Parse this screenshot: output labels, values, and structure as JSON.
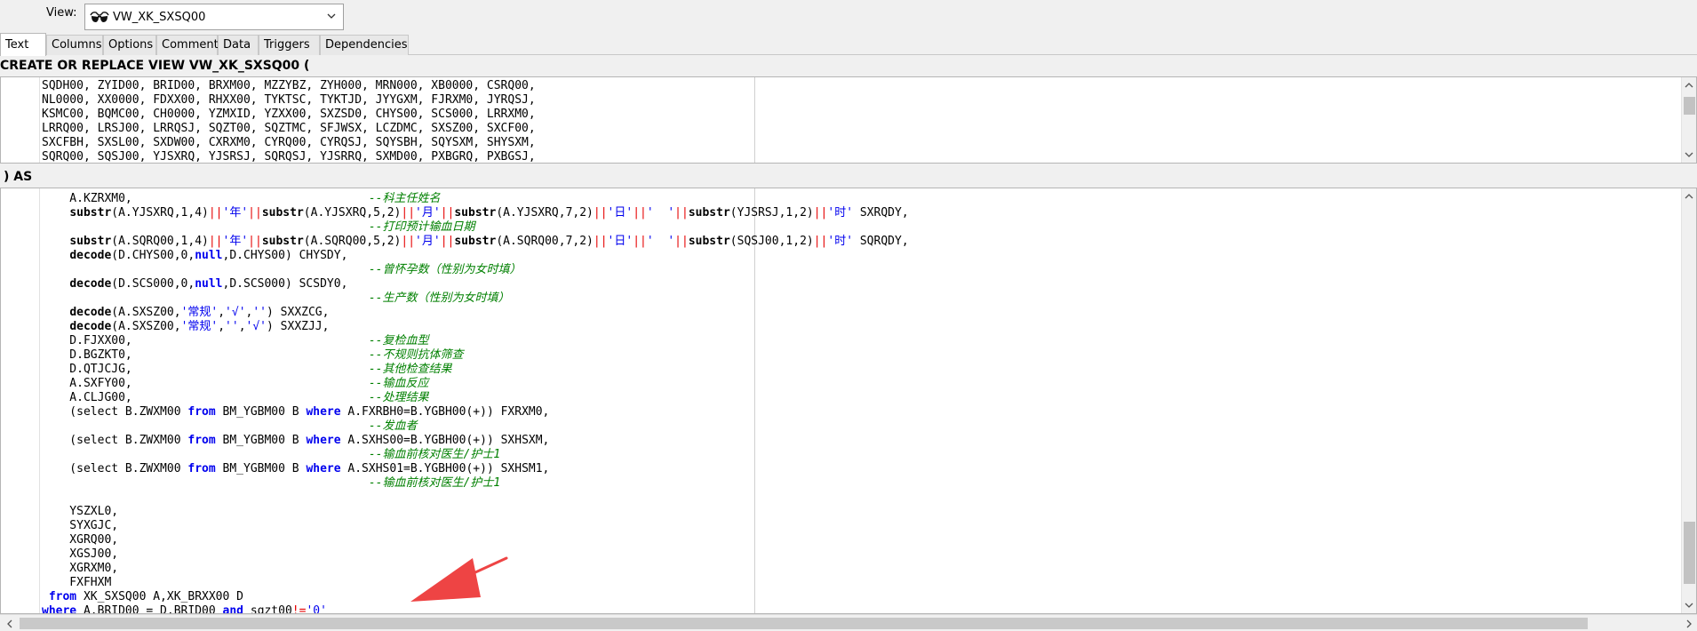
{
  "view_selector": {
    "label": "View:",
    "value": "VW_XK_SXSQ00",
    "icon": "sunglasses-icon"
  },
  "tabs": [
    {
      "label": "Text",
      "active": true
    },
    {
      "label": "Columns",
      "active": false
    },
    {
      "label": "Options",
      "active": false
    },
    {
      "label": "Comment",
      "active": false
    },
    {
      "label": "Data",
      "active": false
    },
    {
      "label": "Triggers",
      "active": false
    },
    {
      "label": "Dependencies",
      "active": false
    }
  ],
  "header_line": "CREATE OR REPLACE VIEW VW_XK_SXSQ00 (",
  "as_line": ") AS",
  "column_list": [
    [
      [
        "id",
        "SQDH00, ZYID00, BRID00, BRXM00, MZZYBZ, ZYH000, MRN000, XB0000, CSRQ00,"
      ]
    ],
    [
      [
        "id",
        "NL0000, XX0000, FDXX00, RHXX00, TYKTSC, TYKTJD, JYYGXM, FJRXM0, JYRQSJ,"
      ]
    ],
    [
      [
        "id",
        "KSMC00, BQMC00, CH0000, YZMXID, YZXX00, SXZSD0, CHYS00, SCS000, LRRXM0,"
      ]
    ],
    [
      [
        "id",
        "LRRQ00, LRSJ00, LRRQSJ, SQZT00, SQZTMC, SFJWSX, LCZDMC, SXSZ00, SXCF00,"
      ]
    ],
    [
      [
        "id",
        "SXCFBH, SXSL00, SXDW00, CXRXM0, CYRQ00, CYRQSJ, SQYSBH, SQYSXM, SHYSXM,"
      ]
    ],
    [
      [
        "id",
        "SQRQ00, SQSJ00, YJSXRQ, YJSRSJ, SQRQSJ, YJSRRQ, SXMD00, PXBGRQ, PXBGSJ,"
      ]
    ]
  ],
  "body_lines": [
    [
      [
        "id",
        "    A.KZRXM0,                                  "
      ],
      [
        "cm",
        "--科主任姓名"
      ]
    ],
    [
      [
        "id",
        "    "
      ],
      [
        "fn",
        "substr"
      ],
      [
        "id",
        "(A.YJSXRQ,1,4)"
      ],
      [
        "op",
        "||"
      ],
      [
        "str",
        "'年'"
      ],
      [
        "op",
        "||"
      ],
      [
        "fn",
        "substr"
      ],
      [
        "id",
        "(A.YJSXRQ,5,2)"
      ],
      [
        "op",
        "||"
      ],
      [
        "str",
        "'月'"
      ],
      [
        "op",
        "||"
      ],
      [
        "fn",
        "substr"
      ],
      [
        "id",
        "(A.YJSXRQ,7,2)"
      ],
      [
        "op",
        "||"
      ],
      [
        "str",
        "'日'"
      ],
      [
        "op",
        "||"
      ],
      [
        "str",
        "'  '"
      ],
      [
        "op",
        "||"
      ],
      [
        "fn",
        "substr"
      ],
      [
        "id",
        "(YJSRSJ,1,2)"
      ],
      [
        "op",
        "||"
      ],
      [
        "str",
        "'时'"
      ],
      [
        "id",
        " SXRQDY,"
      ]
    ],
    [
      [
        "id",
        "                                               "
      ],
      [
        "cm",
        "--打印预计输血日期"
      ]
    ],
    [
      [
        "id",
        "    "
      ],
      [
        "fn",
        "substr"
      ],
      [
        "id",
        "(A.SQRQ00,1,4)"
      ],
      [
        "op",
        "||"
      ],
      [
        "str",
        "'年'"
      ],
      [
        "op",
        "||"
      ],
      [
        "fn",
        "substr"
      ],
      [
        "id",
        "(A.SQRQ00,5,2)"
      ],
      [
        "op",
        "||"
      ],
      [
        "str",
        "'月'"
      ],
      [
        "op",
        "||"
      ],
      [
        "fn",
        "substr"
      ],
      [
        "id",
        "(A.SQRQ00,7,2)"
      ],
      [
        "op",
        "||"
      ],
      [
        "str",
        "'日'"
      ],
      [
        "op",
        "||"
      ],
      [
        "str",
        "'  '"
      ],
      [
        "op",
        "||"
      ],
      [
        "fn",
        "substr"
      ],
      [
        "id",
        "(SQSJ00,1,2)"
      ],
      [
        "op",
        "||"
      ],
      [
        "str",
        "'时'"
      ],
      [
        "id",
        " SQRQDY,"
      ]
    ],
    [
      [
        "id",
        "    "
      ],
      [
        "fn",
        "decode"
      ],
      [
        "id",
        "(D.CHYS00,0,"
      ],
      [
        "kw",
        "null"
      ],
      [
        "id",
        ",D.CHYS00) CHYSDY,"
      ]
    ],
    [
      [
        "id",
        "                                               "
      ],
      [
        "cm",
        "--曾怀孕数（性别为女时填）"
      ]
    ],
    [
      [
        "id",
        "    "
      ],
      [
        "fn",
        "decode"
      ],
      [
        "id",
        "(D.SCS000,0,"
      ],
      [
        "kw",
        "null"
      ],
      [
        "id",
        ",D.SCS000) SCSDY0,"
      ]
    ],
    [
      [
        "id",
        "                                               "
      ],
      [
        "cm",
        "--生产数（性别为女时填）"
      ]
    ],
    [
      [
        "id",
        "    "
      ],
      [
        "fn",
        "decode"
      ],
      [
        "id",
        "(A.SXSZ00,"
      ],
      [
        "str",
        "'常规'"
      ],
      [
        "id",
        ","
      ],
      [
        "str",
        "'√'"
      ],
      [
        "id",
        ","
      ],
      [
        "str",
        "''"
      ],
      [
        "id",
        ") SXXZCG,"
      ]
    ],
    [
      [
        "id",
        "    "
      ],
      [
        "fn",
        "decode"
      ],
      [
        "id",
        "(A.SXSZ00,"
      ],
      [
        "str",
        "'常规'"
      ],
      [
        "id",
        ","
      ],
      [
        "str",
        "''"
      ],
      [
        "id",
        ","
      ],
      [
        "str",
        "'√'"
      ],
      [
        "id",
        ") SXXZJJ,"
      ]
    ],
    [
      [
        "id",
        "    D.FJXX00,                                  "
      ],
      [
        "cm",
        "--复检血型"
      ]
    ],
    [
      [
        "id",
        "    D.BGZKT0,                                  "
      ],
      [
        "cm",
        "--不规则抗体筛查"
      ]
    ],
    [
      [
        "id",
        "    D.QTJCJG,                                  "
      ],
      [
        "cm",
        "--其他检查结果"
      ]
    ],
    [
      [
        "id",
        "    A.SXFY00,                                  "
      ],
      [
        "cm",
        "--输血反应"
      ]
    ],
    [
      [
        "id",
        "    A.CLJG00,                                  "
      ],
      [
        "cm",
        "--处理结果"
      ]
    ],
    [
      [
        "id",
        "    (select B.ZWXM00 "
      ],
      [
        "kw",
        "from"
      ],
      [
        "id",
        " BM_YGBM00 B "
      ],
      [
        "kw",
        "where"
      ],
      [
        "id",
        " A.FXRBH0=B.YGBH00(+)) FXRXM0,"
      ]
    ],
    [
      [
        "id",
        "                                               "
      ],
      [
        "cm",
        "--发血者"
      ]
    ],
    [
      [
        "id",
        "    (select B.ZWXM00 "
      ],
      [
        "kw",
        "from"
      ],
      [
        "id",
        " BM_YGBM00 B "
      ],
      [
        "kw",
        "where"
      ],
      [
        "id",
        " A.SXHS00=B.YGBH00(+)) SXHSXM,"
      ]
    ],
    [
      [
        "id",
        "                                               "
      ],
      [
        "cm",
        "--输血前核对医生/护士1"
      ]
    ],
    [
      [
        "id",
        "    (select B.ZWXM00 "
      ],
      [
        "kw",
        "from"
      ],
      [
        "id",
        " BM_YGBM00 B "
      ],
      [
        "kw",
        "where"
      ],
      [
        "id",
        " A.SXHS01=B.YGBH00(+)) SXHSM1,"
      ]
    ],
    [
      [
        "id",
        "                                               "
      ],
      [
        "cm",
        "--输血前核对医生/护士1"
      ]
    ],
    [
      [
        "id",
        ""
      ]
    ],
    [
      [
        "id",
        "    YSZXL0,"
      ]
    ],
    [
      [
        "id",
        "    SYXGJC,"
      ]
    ],
    [
      [
        "id",
        "    XGRQ00,"
      ]
    ],
    [
      [
        "id",
        "    XGSJ00,"
      ]
    ],
    [
      [
        "id",
        "    XGRXM0,"
      ]
    ],
    [
      [
        "id",
        "    FXFHXM"
      ]
    ],
    [
      [
        "id",
        " "
      ],
      [
        "kw",
        "from"
      ],
      [
        "id",
        " XK_SXSQ00 A,XK_BRXX00 D"
      ]
    ],
    [
      [
        "kw",
        "where"
      ],
      [
        "id",
        " A.BRID00 = D.BRID00 "
      ],
      [
        "kw",
        "and"
      ],
      [
        "id",
        " sqzt00"
      ],
      [
        "op",
        "!="
      ],
      [
        "str",
        "'0'"
      ]
    ]
  ],
  "colors": {
    "keyword": "#0000ee",
    "operator": "#e60000",
    "comment": "#008000",
    "annotation_arrow": "#ee4444"
  }
}
